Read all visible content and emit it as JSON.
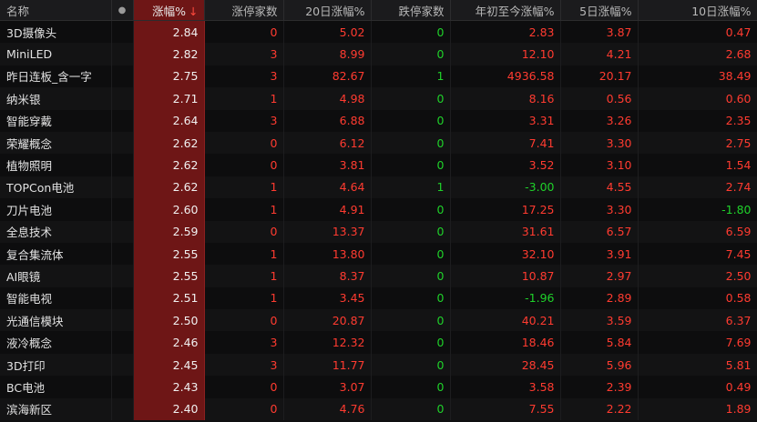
{
  "headers": {
    "name": "名称",
    "dot": "●",
    "change": "涨幅%",
    "sort_arrow": "↓",
    "limit_up": "涨停家数",
    "change_20d": "20日涨幅%",
    "limit_down": "跌停家数",
    "ytd": "年初至今涨幅%",
    "change_5d": "5日涨幅%",
    "change_10d": "10日涨幅%"
  },
  "colors": {
    "up": "#ff3b30",
    "down": "#1fd12a",
    "sorted_col_bg": "#6e1616"
  },
  "rows": [
    {
      "name": "3D摄像头",
      "change": "2.84",
      "limit_up": "0",
      "change_20d": "5.02",
      "limit_down": "0",
      "ytd": "2.83",
      "change_5d": "3.87",
      "change_10d": "0.47"
    },
    {
      "name": "MiniLED",
      "change": "2.82",
      "limit_up": "3",
      "change_20d": "8.99",
      "limit_down": "0",
      "ytd": "12.10",
      "change_5d": "4.21",
      "change_10d": "2.68"
    },
    {
      "name": "昨日连板_含一字",
      "change": "2.75",
      "limit_up": "3",
      "change_20d": "82.67",
      "limit_down": "1",
      "ytd": "4936.58",
      "change_5d": "20.17",
      "change_10d": "38.49"
    },
    {
      "name": "纳米银",
      "change": "2.71",
      "limit_up": "1",
      "change_20d": "4.98",
      "limit_down": "0",
      "ytd": "8.16",
      "change_5d": "0.56",
      "change_10d": "0.60"
    },
    {
      "name": "智能穿戴",
      "change": "2.64",
      "limit_up": "3",
      "change_20d": "6.88",
      "limit_down": "0",
      "ytd": "3.31",
      "change_5d": "3.26",
      "change_10d": "2.35"
    },
    {
      "name": "荣耀概念",
      "change": "2.62",
      "limit_up": "0",
      "change_20d": "6.12",
      "limit_down": "0",
      "ytd": "7.41",
      "change_5d": "3.30",
      "change_10d": "2.75"
    },
    {
      "name": "植物照明",
      "change": "2.62",
      "limit_up": "0",
      "change_20d": "3.81",
      "limit_down": "0",
      "ytd": "3.52",
      "change_5d": "3.10",
      "change_10d": "1.54"
    },
    {
      "name": "TOPCon电池",
      "change": "2.62",
      "limit_up": "1",
      "change_20d": "4.64",
      "limit_down": "1",
      "ytd": "-3.00",
      "change_5d": "4.55",
      "change_10d": "2.74"
    },
    {
      "name": "刀片电池",
      "change": "2.60",
      "limit_up": "1",
      "change_20d": "4.91",
      "limit_down": "0",
      "ytd": "17.25",
      "change_5d": "3.30",
      "change_10d": "-1.80"
    },
    {
      "name": "全息技术",
      "change": "2.59",
      "limit_up": "0",
      "change_20d": "13.37",
      "limit_down": "0",
      "ytd": "31.61",
      "change_5d": "6.57",
      "change_10d": "6.59"
    },
    {
      "name": "复合集流体",
      "change": "2.55",
      "limit_up": "1",
      "change_20d": "13.80",
      "limit_down": "0",
      "ytd": "32.10",
      "change_5d": "3.91",
      "change_10d": "7.45"
    },
    {
      "name": "AI眼镜",
      "change": "2.55",
      "limit_up": "1",
      "change_20d": "8.37",
      "limit_down": "0",
      "ytd": "10.87",
      "change_5d": "2.97",
      "change_10d": "2.50"
    },
    {
      "name": "智能电视",
      "change": "2.51",
      "limit_up": "1",
      "change_20d": "3.45",
      "limit_down": "0",
      "ytd": "-1.96",
      "change_5d": "2.89",
      "change_10d": "0.58"
    },
    {
      "name": "光通信模块",
      "change": "2.50",
      "limit_up": "0",
      "change_20d": "20.87",
      "limit_down": "0",
      "ytd": "40.21",
      "change_5d": "3.59",
      "change_10d": "6.37"
    },
    {
      "name": "液冷概念",
      "change": "2.46",
      "limit_up": "3",
      "change_20d": "12.32",
      "limit_down": "0",
      "ytd": "18.46",
      "change_5d": "5.84",
      "change_10d": "7.69"
    },
    {
      "name": "3D打印",
      "change": "2.45",
      "limit_up": "3",
      "change_20d": "11.77",
      "limit_down": "0",
      "ytd": "28.45",
      "change_5d": "5.96",
      "change_10d": "5.81"
    },
    {
      "name": "BC电池",
      "change": "2.43",
      "limit_up": "0",
      "change_20d": "3.07",
      "limit_down": "0",
      "ytd": "3.58",
      "change_5d": "2.39",
      "change_10d": "0.49"
    },
    {
      "name": "滨海新区",
      "change": "2.40",
      "limit_up": "0",
      "change_20d": "4.76",
      "limit_down": "0",
      "ytd": "7.55",
      "change_5d": "2.22",
      "change_10d": "1.89"
    }
  ]
}
